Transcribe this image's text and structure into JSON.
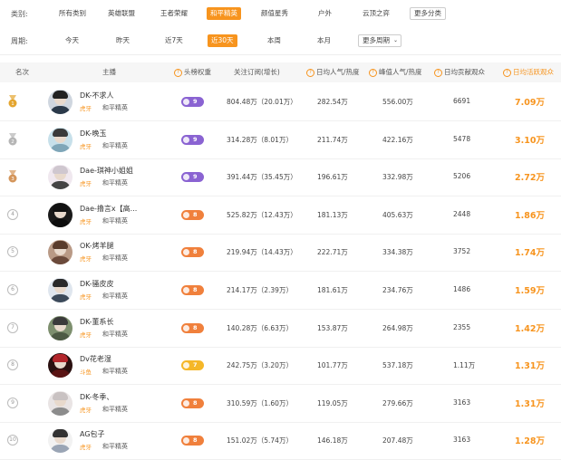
{
  "filters": {
    "category_label": "类别:",
    "categories": [
      "所有类别",
      "英雄联盟",
      "王者荣耀",
      "和平精英",
      "颜值星秀",
      "户外",
      "云顶之弈",
      "更多分类"
    ],
    "category_active": 3,
    "period_label": "周期:",
    "periods": [
      "今天",
      "昨天",
      "近7天",
      "近30天",
      "本周",
      "本月",
      "更多周期"
    ],
    "period_active": 3
  },
  "table": {
    "headers": {
      "rank": "名次",
      "anchor": "主播",
      "weight": "头榜权重",
      "follow": "关注订阅(增长)",
      "avg_pop": "日均人气/热度",
      "peak_pop": "峰值人气/热度",
      "avg_gift": "日均贡献观众",
      "avg_active": "日均活跃观众"
    },
    "rows": [
      {
        "rank": "1",
        "name": "DK-不求人",
        "platform": "虎牙",
        "game": "和平精英",
        "level": "9",
        "level_color": "#8a63d2",
        "follow": "804.48万（20.01万）",
        "avg_pop": "282.54万",
        "peak_pop": "556.00万",
        "avg_gift": "6691",
        "avg_active": "7.09万",
        "avatar_bg": "#cfd6df",
        "avatar_hair": "#222",
        "avatar_body": "#2b3a4a"
      },
      {
        "rank": "2",
        "name": "DK-晚玉",
        "platform": "虎牙",
        "game": "和平精英",
        "level": "9",
        "level_color": "#8a63d2",
        "follow": "314.28万（8.01万）",
        "avg_pop": "211.74万",
        "peak_pop": "422.16万",
        "avg_gift": "5478",
        "avg_active": "3.10万",
        "avatar_bg": "#c7e0ea",
        "avatar_hair": "#3a3a3a",
        "avatar_body": "#7fa6b8"
      },
      {
        "rank": "3",
        "name": "Dae-琪神小姐姐",
        "platform": "虎牙",
        "game": "和平精英",
        "level": "9",
        "level_color": "#8a63d2",
        "follow": "391.44万（35.45万）",
        "avg_pop": "196.61万",
        "peak_pop": "332.98万",
        "avg_gift": "5206",
        "avg_active": "2.72万",
        "avatar_bg": "#f0e8ef",
        "avatar_hair": "#cfc7cf",
        "avatar_body": "#444"
      },
      {
        "rank": "4",
        "name": "Dae-撸言x【高...",
        "platform": "虎牙",
        "game": "和平精英",
        "level": "8",
        "level_color": "#f0803c",
        "follow": "525.82万（12.43万）",
        "avg_pop": "181.13万",
        "peak_pop": "405.63万",
        "avg_gift": "2448",
        "avg_active": "1.86万",
        "avatar_bg": "#1a1a1a",
        "avatar_hair": "#111",
        "avatar_body": "#0d0d0d"
      },
      {
        "rank": "5",
        "name": "OK-烤羊腿",
        "platform": "虎牙",
        "game": "和平精英",
        "level": "8",
        "level_color": "#f0803c",
        "follow": "219.94万（14.43万）",
        "avg_pop": "222.71万",
        "peak_pop": "334.38万",
        "avg_gift": "3752",
        "avg_active": "1.74万",
        "avatar_bg": "#b99a86",
        "avatar_hair": "#5a3c2c",
        "avatar_body": "#6b4a3b"
      },
      {
        "rank": "6",
        "name": "DK-骚皮皮",
        "platform": "虎牙",
        "game": "和平精英",
        "level": "8",
        "level_color": "#f0803c",
        "follow": "214.17万（2.39万）",
        "avg_pop": "181.61万",
        "peak_pop": "234.76万",
        "avg_gift": "1486",
        "avg_active": "1.59万",
        "avatar_bg": "#dfe6ee",
        "avatar_hair": "#2a2a2a",
        "avatar_body": "#3c4a5a"
      },
      {
        "rank": "7",
        "name": "DK-董系长",
        "platform": "虎牙",
        "game": "和平精英",
        "level": "8",
        "level_color": "#f0803c",
        "follow": "140.28万（6.63万）",
        "avg_pop": "153.87万",
        "peak_pop": "264.98万",
        "avg_gift": "2355",
        "avg_active": "1.42万",
        "avatar_bg": "#7d8f6e",
        "avatar_hair": "#3b3b3b",
        "avatar_body": "#4d5a44"
      },
      {
        "rank": "8",
        "name": "Dv花老湿",
        "platform": "斗鱼",
        "game": "和平精英",
        "level": "7",
        "level_color": "#f5b728",
        "follow": "242.75万（3.20万）",
        "avg_pop": "101.77万",
        "peak_pop": "537.18万",
        "avg_gift": "1.11万",
        "avg_active": "1.31万",
        "avatar_bg": "#2a1010",
        "avatar_hair": "#b3262b",
        "avatar_body": "#5a1414"
      },
      {
        "rank": "9",
        "name": "DK-冬季、",
        "platform": "虎牙",
        "game": "和平精英",
        "level": "8",
        "level_color": "#f0803c",
        "follow": "310.59万（1.60万）",
        "avg_pop": "119.05万",
        "peak_pop": "279.66万",
        "avg_gift": "3163",
        "avg_active": "1.31万",
        "avatar_bg": "#e9e4e4",
        "avatar_hair": "#c9c2c2",
        "avatar_body": "#8c8c8c"
      },
      {
        "rank": "10",
        "name": "AG包子",
        "platform": "虎牙",
        "game": "和平精英",
        "level": "8",
        "level_color": "#f0803c",
        "follow": "151.02万（5.74万）",
        "avg_pop": "146.18万",
        "peak_pop": "207.48万",
        "avg_gift": "3163",
        "avg_active": "1.28万",
        "avatar_bg": "#f2f2f2",
        "avatar_hair": "#333",
        "avatar_body": "#9aa5b5"
      }
    ]
  },
  "colors": {
    "accent": "#f7941e",
    "gold": "#e4a52f",
    "silver": "#b5b5b5",
    "bronze": "#d4955a"
  }
}
